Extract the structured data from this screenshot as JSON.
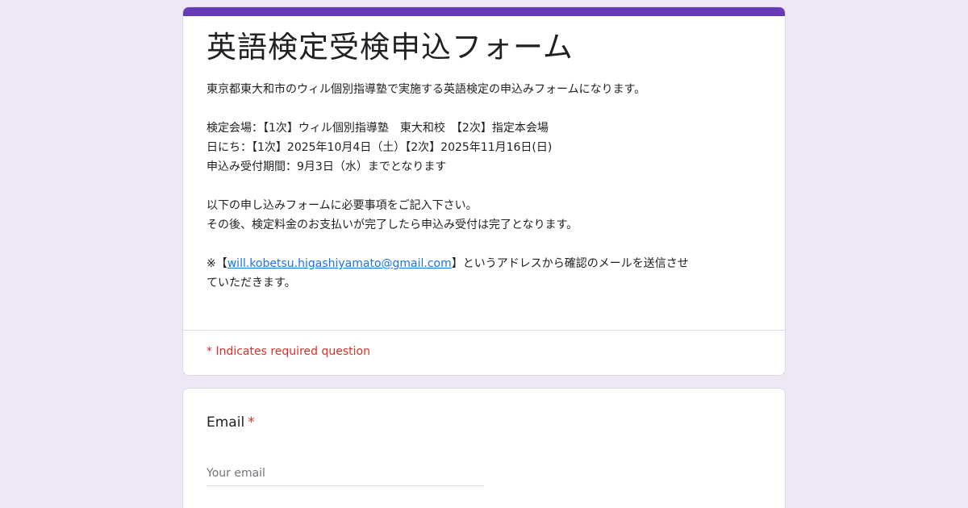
{
  "form": {
    "title": "英語検定受検申込フォーム",
    "description_lines": [
      "東京都東大和市のウィル個別指導塾で実施する英語検定の申込みフォームになります。",
      "",
      "検定会場：【1次】ウィル個別指導塾　東大和校　【2次】指定本会場",
      "日にち：【1次】2025年10月4日（土）【2次】2025年11月16日(日)",
      "申込み受付期間：9月3日（水）までとなります",
      "",
      "以下の申し込みフォームに必要事項をご記入下さい。",
      "その後、検定料金のお支払いが完了したら申込み受付は完了となります。",
      ""
    ],
    "email_note": {
      "prefix": "※【",
      "email_link": "will.kobetsu.higashiyamato@gmail.com",
      "suffix_line1": "】というアドレスから確認のメールを送信させ",
      "line2": "ていただきます。"
    },
    "required_note": "* Indicates required question",
    "accent_color": "#673ab7",
    "required_color": "#d93025"
  },
  "questions": {
    "email": {
      "label": "Email",
      "required_mark": "*",
      "placeholder": "Your email",
      "value": ""
    }
  }
}
